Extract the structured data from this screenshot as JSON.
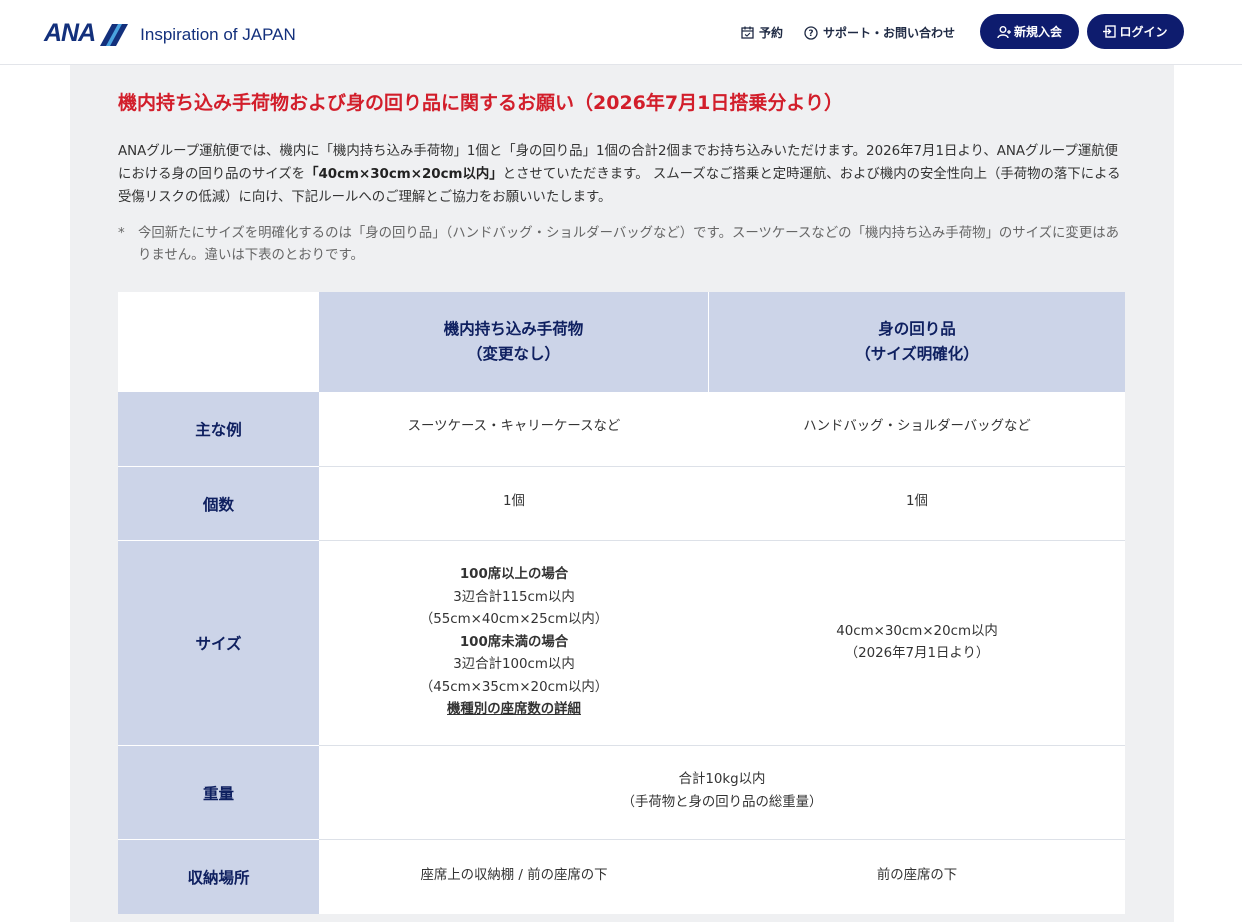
{
  "header": {
    "logo_text": "ANA",
    "tagline": "Inspiration of JAPAN",
    "reserve_label": "予約",
    "support_label": "サポート・お問い合わせ",
    "signup_label": "新規入会",
    "login_label": "ログイン",
    "brand_color": "#13307c",
    "button_color": "#0e1c6e"
  },
  "main": {
    "title": "機内持ち込み手荷物および身の回り品に関するお願い（2026年7月1日搭乗分より）",
    "intro_part1": "ANAグループ運航便では、機内に「機内持ち込み手荷物」1個と「身の回り品」1個の合計2個までお持ち込みいただけます。2026年7月1日より、ANAグループ運航便における身の回り品のサイズを",
    "intro_bold": "「40cm×30cm×20cm以内」",
    "intro_part2": "とさせていただきます。 スムーズなご搭乗と定時運航、および機内の安全性向上（手荷物の落下による受傷リスクの低減）に向け、下記ルールへのご理解とご協力をお願いいたします。",
    "note_mark": "*",
    "note_text": "今回新たにサイズを明確化するのは「身の回り品」（ハンドバッグ・ショルダーバッグなど）です。スーツケースなどの「機内持ち込み手荷物」のサイズに変更はありません。違いは下表のとおりです。",
    "title_color": "#d21e2b"
  },
  "table": {
    "col1_title": "機内持ち込み手荷物",
    "col1_sub": "（変更なし）",
    "col2_title": "身の回り品",
    "col2_sub": "（サイズ明確化）",
    "row_example_label": "主な例",
    "row_example_col1": "スーツケース・キャリーケースなど",
    "row_example_col2": "ハンドバッグ・ショルダーバッグなど",
    "row_count_label": "個数",
    "row_count_col1": "1個",
    "row_count_col2": "1個",
    "row_size_label": "サイズ",
    "size_col1_h1": "100席以上の場合",
    "size_col1_l1": "3辺合計115cm以内",
    "size_col1_l2": "（55cm×40cm×25cm以内）",
    "size_col1_h2": "100席未満の場合",
    "size_col1_l3": "3辺合計100cm以内",
    "size_col1_l4": "（45cm×35cm×20cm以内）",
    "size_col1_link": "機種別の座席数の詳細",
    "size_col2_l1": "40cm×30cm×20cm以内",
    "size_col2_l2": "（2026年7月1日より）",
    "row_weight_label": "重量",
    "weight_l1": "合計10kg以内",
    "weight_l2": "（手荷物と身の回り品の総重量）",
    "row_storage_label": "収納場所",
    "storage_col1": "座席上の収納棚 / 前の座席の下",
    "storage_col2": "前の座席の下",
    "header_bg": "#ccd4e8"
  }
}
